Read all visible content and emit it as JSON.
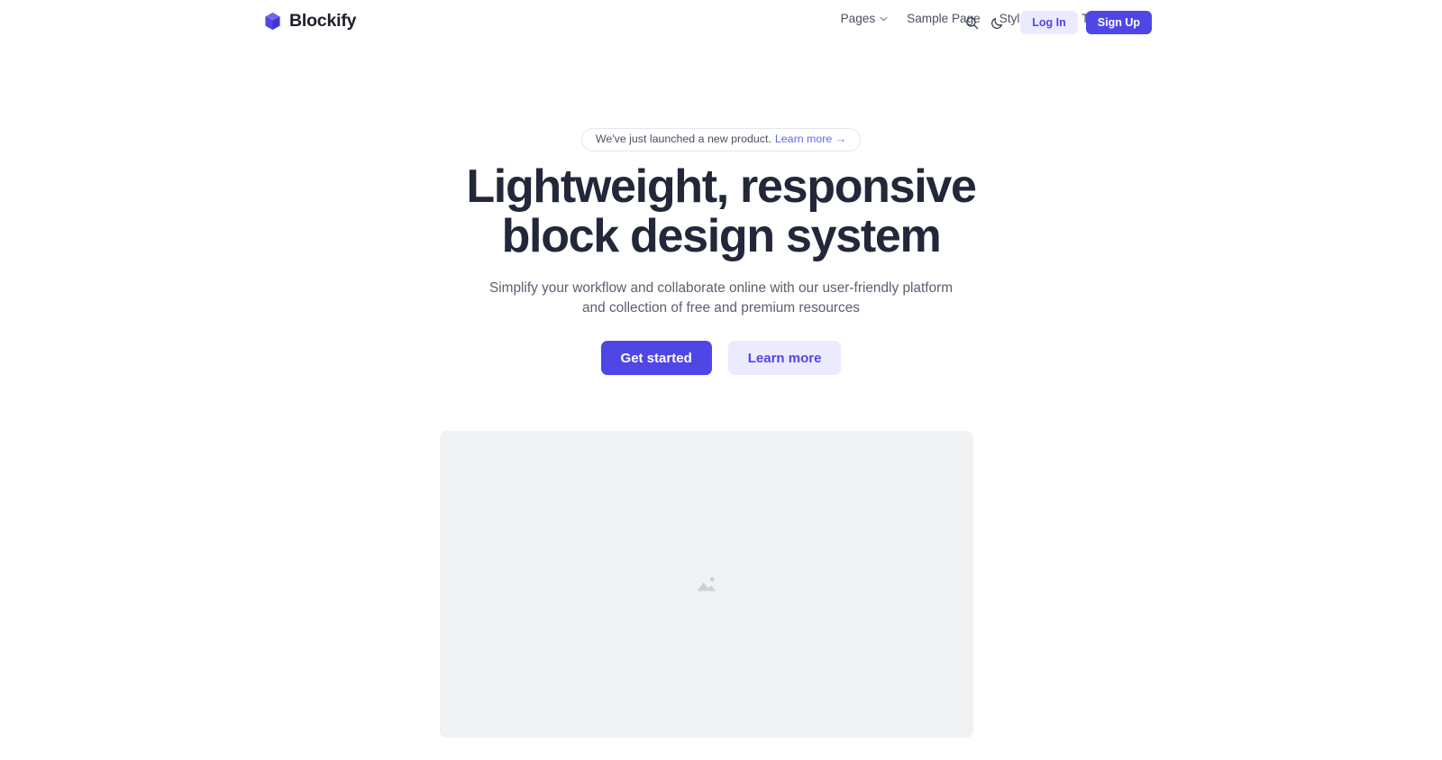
{
  "brand": {
    "name": "Blockify",
    "logo_icon": "cube-icon",
    "logo_color": "#4f46e5"
  },
  "header": {
    "nav": [
      {
        "label": "Pages",
        "has_dropdown": true
      },
      {
        "label": "Sample Page",
        "has_dropdown": false
      },
      {
        "label": "Style Guide",
        "has_dropdown": false
      },
      {
        "label": "Templates",
        "has_dropdown": true
      }
    ],
    "search_icon": "search-icon",
    "theme_icon": "moon-icon",
    "login_label": "Log In",
    "signup_label": "Sign Up"
  },
  "hero": {
    "badge_text": "We've just launched a new product.",
    "badge_link": "Learn more →",
    "headline_line1": "Lightweight, responsive",
    "headline_line2": "block design system",
    "subhead": "Simplify your workflow and collaborate online with our user-friendly platform and collection of free and premium resources",
    "cta_primary": "Get started",
    "cta_secondary": "Learn more",
    "media_icon": "image-placeholder-icon"
  },
  "colors": {
    "accent": "#4f46e5",
    "accent_light": "#eceaff",
    "link": "#6366f1",
    "heading": "#222839",
    "body_text": "#5a6070",
    "placeholder_bg": "#f1f2f4",
    "border": "#e6e7eb"
  }
}
